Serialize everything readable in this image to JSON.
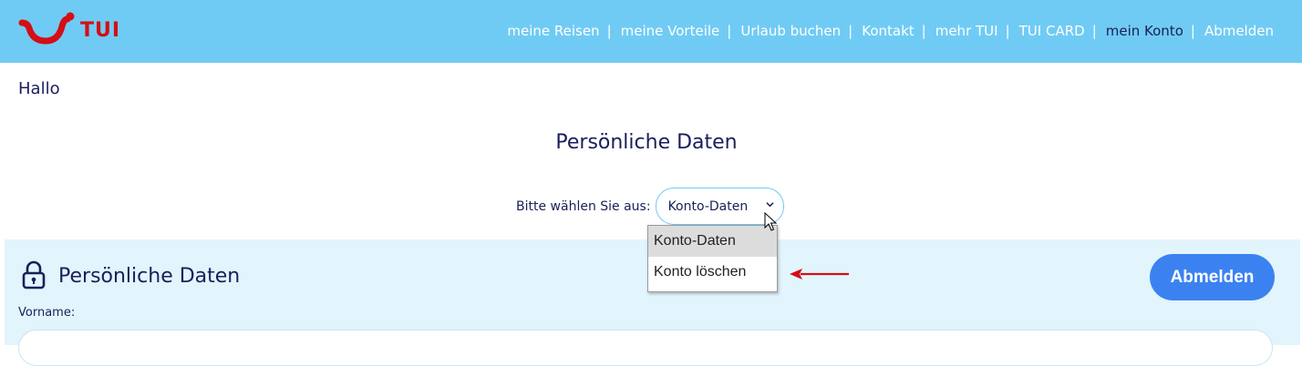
{
  "header": {
    "brand": "TUI",
    "brand_color": "#d40e14",
    "background": "#70cbf4",
    "nav": [
      {
        "label": "meine Reisen"
      },
      {
        "label": "meine Vorteile"
      },
      {
        "label": "Urlaub buchen"
      },
      {
        "label": "Kontakt"
      },
      {
        "label": "mehr TUI"
      },
      {
        "label": "TUI CARD"
      },
      {
        "label": "mein Konto",
        "active": true
      },
      {
        "label": "Abmelden"
      }
    ],
    "separator": "|"
  },
  "greeting": "Hallo",
  "page_title": "Persönliche Daten",
  "select": {
    "label": "Bitte wählen Sie aus:",
    "value": "Konto-Daten",
    "options": [
      "Konto-Daten",
      "Konto löschen"
    ],
    "highlighted_index": 0
  },
  "panel": {
    "title": "Persönliche Daten",
    "logout_label": "Abmelden",
    "logout_color": "#3b82f0",
    "fields": [
      {
        "label": "Vorname:",
        "value": ""
      }
    ]
  },
  "icons": {
    "lock": "lock-icon",
    "chevron": "chevron-down-icon",
    "annotation_arrow": "red-arrow-icon",
    "cursor": "mouse-cursor-icon"
  },
  "annotation_color": "#d40e14"
}
